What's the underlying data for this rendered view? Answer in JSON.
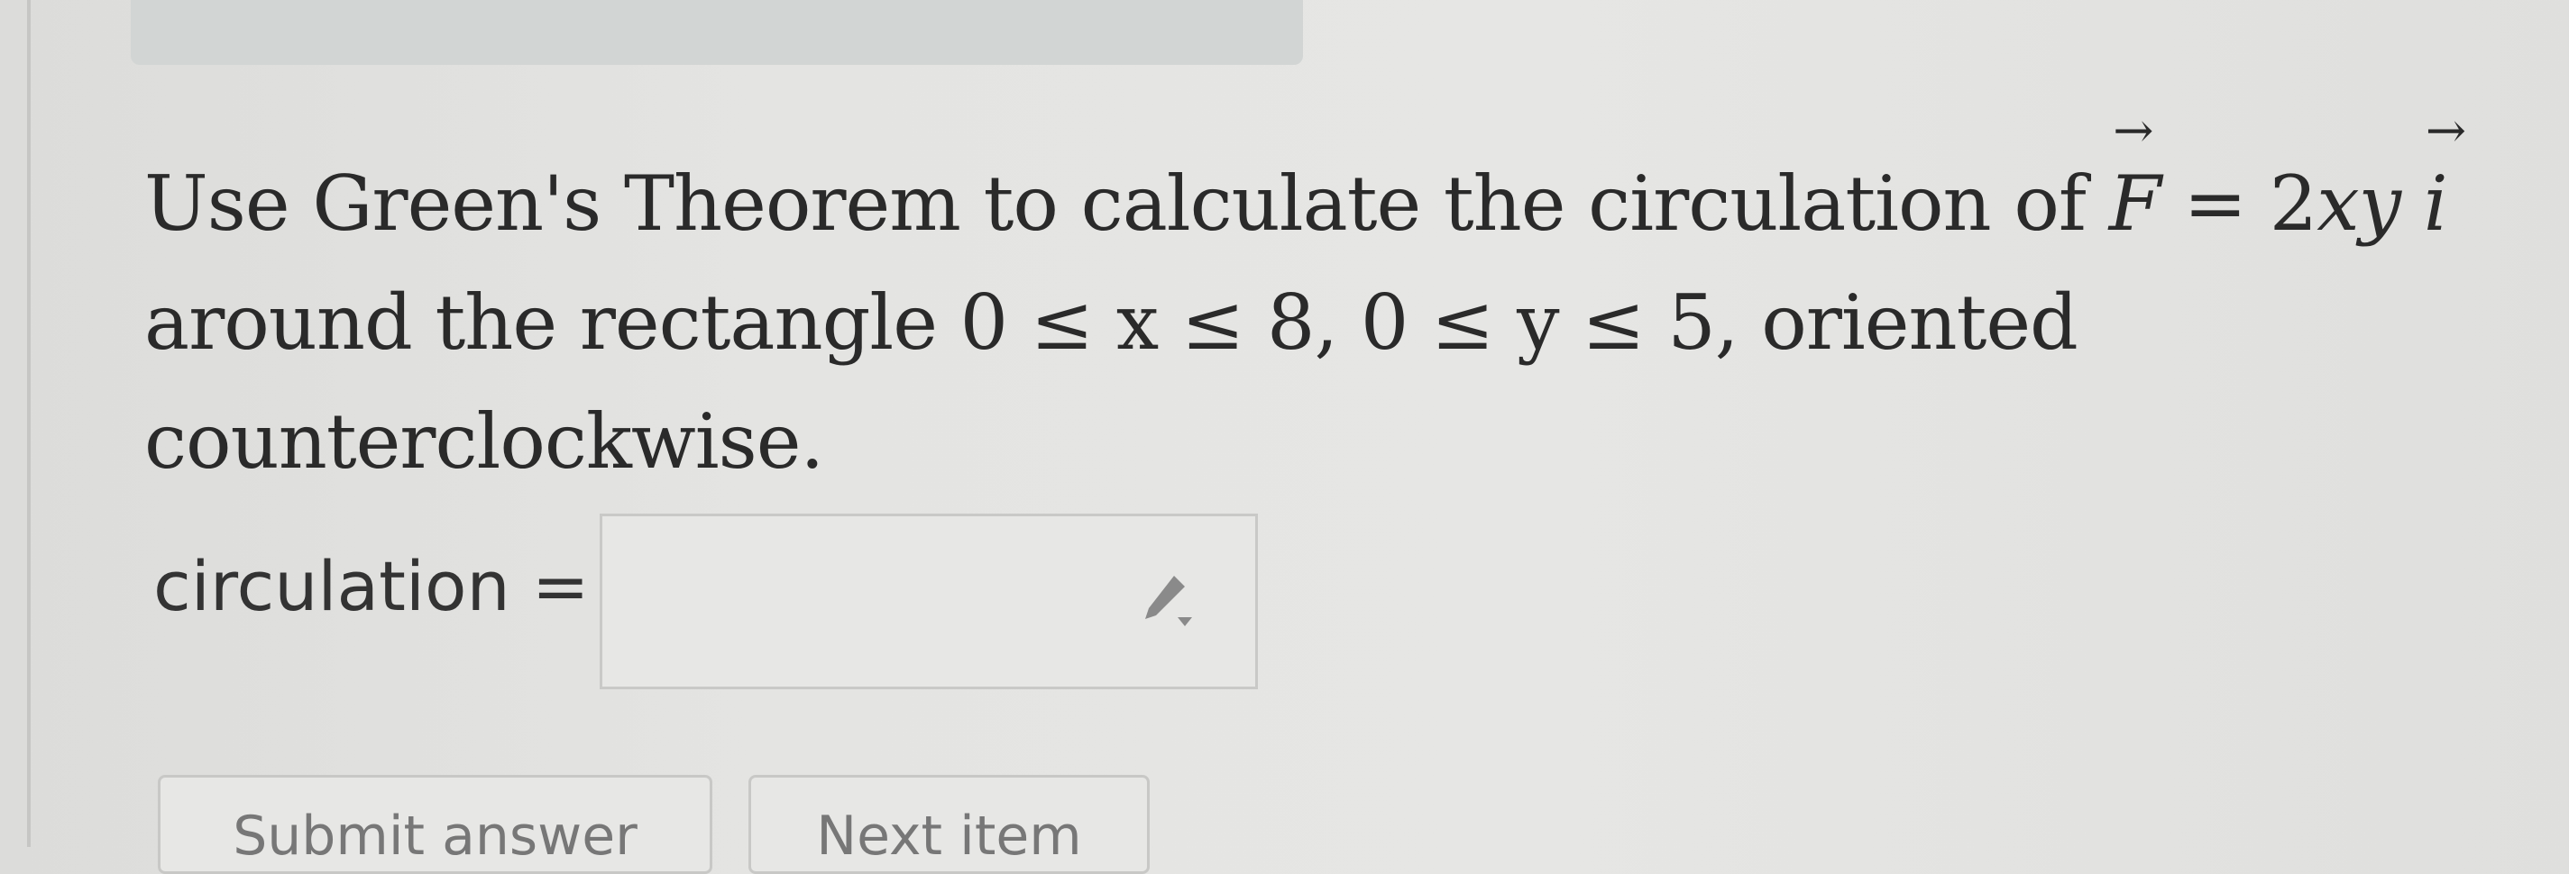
{
  "question": {
    "line1_prefix": "Use Green's Theorem to calculate the circulation of ",
    "vector_F": "F",
    "equals": " = 2",
    "xy": "xy",
    "vector_i": "i",
    "line2": "around the rectangle 0 ≤ x ≤ 8, 0 ≤ y ≤ 5, oriented",
    "line3": "counterclockwise."
  },
  "answer": {
    "label": "circulation =",
    "value": "",
    "edit_icon": "pencil-dropdown-icon"
  },
  "buttons": {
    "submit_label": "Submit answer",
    "second_label": "Next item"
  },
  "colors": {
    "background": "#e4e4e2",
    "text": "#2a2a2a",
    "box_border": "#c9c9c7",
    "top_bar": "#d2d5d4"
  }
}
